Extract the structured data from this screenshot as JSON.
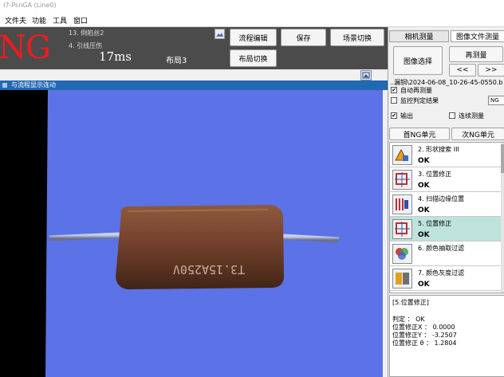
{
  "window": {
    "title": "I7-PsnGA (Line0)"
  },
  "menu": [
    "文件夫",
    "功能",
    "工具",
    "窗口"
  ],
  "header": {
    "judgement": "NG",
    "errors": [
      "13. 倒陷丝2",
      "4. 引线压伤"
    ],
    "time": "17ms",
    "layout": "布局3",
    "buttons": {
      "flow_edit": "流程编辑",
      "save": "保存",
      "scene_switch": "场景切换",
      "layout_switch": "布局切换"
    }
  },
  "image_panel": {
    "title": "与流程显示连动",
    "part_marking": "T3.15A250V"
  },
  "right_panel": {
    "tabs": [
      "相机测量",
      "图像文件测量"
    ],
    "select_image": "图像选择",
    "remeasure": "再测量",
    "prev": "<<",
    ">>": ">>",
    "next": ">>",
    "file_path": "..漏铜\\2024-06-08_10-26-45-0550.b",
    "auto_remeasure": "自动再测量",
    "auto_remeasure_checked": true,
    "monitor_judgement": "监控判定结果",
    "monitor_checked": false,
    "monitor_value": "NG",
    "output": "输出",
    "output_checked": true,
    "continuous": "连续测量",
    "continuous_checked": false,
    "first_ng": "首NG单元",
    "next_ng": "次NG单元",
    "units": [
      {
        "name": "2. 形状搜索 III",
        "status": "OK",
        "icon": "shape-search-icon"
      },
      {
        "name": "3. 位置修正",
        "status": "OK",
        "icon": "position-correction-icon"
      },
      {
        "name": "4. 扫描边缘位置",
        "status": "OK",
        "icon": "scan-edge-icon"
      },
      {
        "name": "5. 位置修正",
        "status": "OK",
        "icon": "position-correction-icon",
        "selected": true
      },
      {
        "name": "6. 颜色抽取过滤",
        "status": "",
        "icon": "color-extract-icon"
      },
      {
        "name": "7. 颜色灰度过滤",
        "status": "OK",
        "icon": "color-gray-filter-icon"
      }
    ],
    "detail": {
      "heading": "[5.位置修正]",
      "judgement": "判定 ： OK",
      "x": "位置修正X ： 0.0000",
      "y": "位置修正Y ： -3.2507",
      "theta": "位置修正 θ ： 1.2804"
    }
  },
  "colors": {
    "ng_red": "#ee1c1c",
    "header_bg": "#4b4b4b",
    "title_blue": "#2268b4",
    "image_bg": "#5b73e6",
    "selected_unit": "#bde3dc"
  }
}
